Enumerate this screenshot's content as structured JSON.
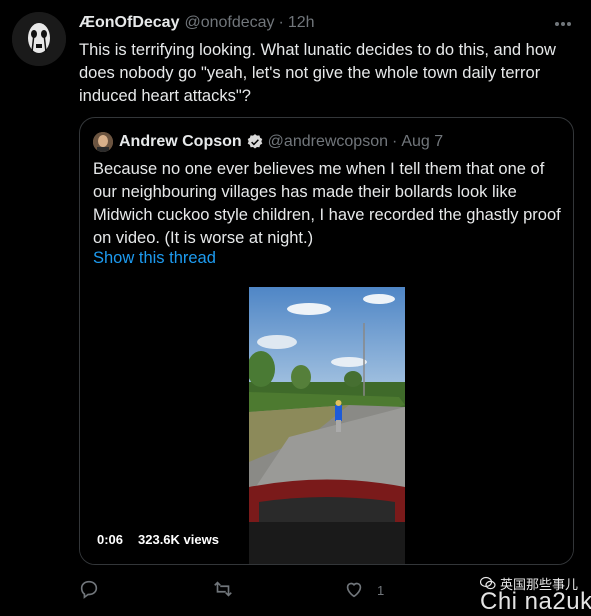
{
  "tweet": {
    "display_name": "ÆonOfDecay",
    "handle": "@onofdecay",
    "separator": "·",
    "time": "12h",
    "text": "This is terrifying looking. What lunatic decides to do this, and how does nobody go \"yeah, let's not give the whole town daily terror induced heart attacks\"?"
  },
  "quote": {
    "display_name": "Andrew Copson",
    "handle": "@andrewcopson",
    "separator": "·",
    "date": "Aug 7",
    "text": "Because no one ever believes me when I tell them that one of our neighbouring villages has made their bollards look like Midwich cuckoo style children, I have recorded the ghastly proof on video. (It is worse at night.)",
    "show_thread": "Show this thread",
    "video": {
      "duration": "0:06",
      "views": "323.6K views"
    }
  },
  "actions": {
    "like_count": "1"
  },
  "watermark": {
    "text": "英国那些事儿",
    "big": "Chi na2uk"
  },
  "colors": {
    "background": "#000000",
    "link": "#1d9bf0",
    "muted": "#71767b",
    "verified": "#1d9bf0"
  },
  "icons": [
    "more-icon",
    "verified-icon",
    "reply-icon",
    "retweet-icon",
    "like-icon",
    "wechat-icon"
  ]
}
